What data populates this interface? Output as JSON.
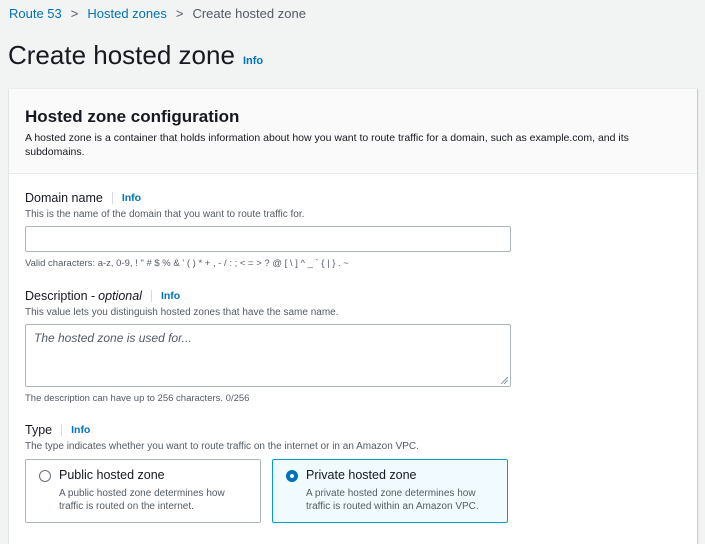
{
  "breadcrumb": {
    "items": [
      "Route 53",
      "Hosted zones",
      "Create hosted zone"
    ],
    "separator": ">"
  },
  "page": {
    "title": "Create hosted zone",
    "info": "Info"
  },
  "config": {
    "title": "Hosted zone configuration",
    "description": "A hosted zone is a container that holds information about how you want to route traffic for a domain, such as example.com, and its subdomains."
  },
  "domain": {
    "label": "Domain name",
    "info": "Info",
    "description": "This is the name of the domain that you want to route traffic for.",
    "value": "",
    "constraint": "Valid characters: a-z, 0-9, ! \" # $ % & ' ( ) * + , - / : ; < = > ? @ [ \\ ] ^ _ ` { | } . ~"
  },
  "description_field": {
    "label": "Description -",
    "optional": "optional",
    "info": "Info",
    "description": "This value lets you distinguish hosted zones that have the same name.",
    "placeholder": "The hosted zone is used for...",
    "constraint": "The description can have up to 256 characters. 0/256"
  },
  "type": {
    "label": "Type",
    "info": "Info",
    "description": "The type indicates whether you want to route traffic on the internet or in an Amazon VPC.",
    "options": [
      {
        "title": "Public hosted zone",
        "description": "A public hosted zone determines how traffic is routed on the internet.",
        "selected": false
      },
      {
        "title": "Private hosted zone",
        "description": "A private hosted zone determines how traffic is routed within an Amazon VPC.",
        "selected": true
      }
    ]
  },
  "colors": {
    "link": "#0073bb",
    "selected_border": "#00a1c9",
    "selected_bg": "#f1faff"
  }
}
